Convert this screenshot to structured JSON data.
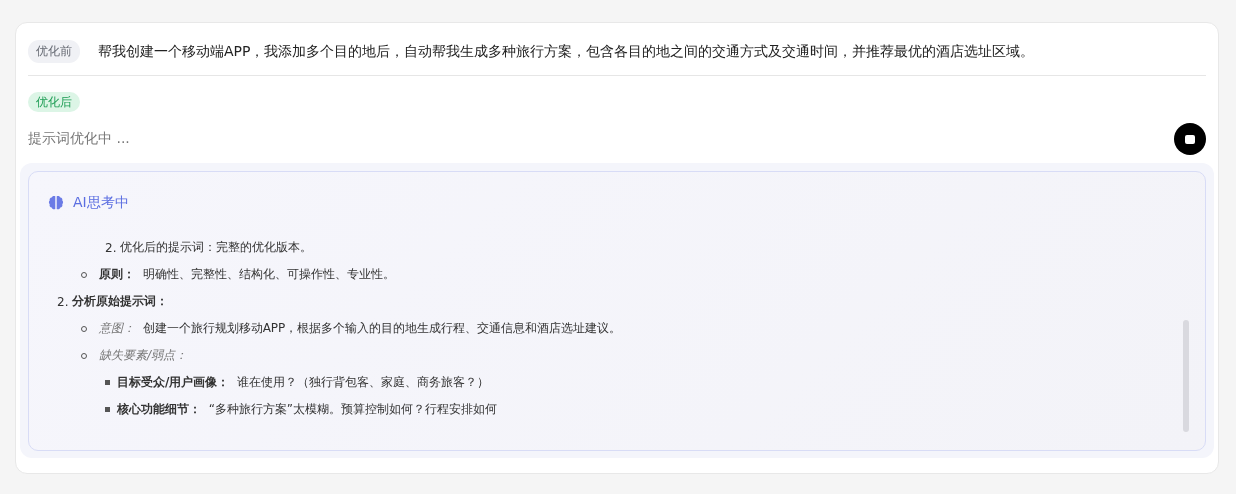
{
  "original": {
    "badge": "优化前",
    "text": "帮我创建一个移动端APP，我添加多个目的地后，自动帮我生成多种旅行方案，包含各目的地之间的交通方式及交通时间，并推荐最优的酒店选址区域。"
  },
  "optimized": {
    "badge": "优化后",
    "status": "提示词优化中 ..."
  },
  "thinking": {
    "title": "AI思考中",
    "outline": [
      {
        "children": [
          {
            "children": [
              {
                "kind": "numbered",
                "marker": "2.",
                "text": "优化后的提示词：完整的优化版本。"
              }
            ]
          },
          {
            "kind": "circle",
            "text": "**原则：**  明确性、完整性、结构化、可操作性、专业性。"
          }
        ]
      },
      {
        "kind": "numbered",
        "marker": "2.",
        "text": "**分析原始提示词：**",
        "children": [
          {
            "kind": "circle",
            "text": "*意图：*  创建一个旅行规划移动APP，根据多个输入的目的地生成行程、交通信息和酒店选址建议。"
          },
          {
            "kind": "circle",
            "text": "*缺失要素/弱点：*",
            "children": [
              {
                "kind": "square",
                "text": "**目标受众/用户画像：**  谁在使用？（独行背包客、家庭、商务旅客？）"
              },
              {
                "kind": "square",
                "text": "**核心功能细节：**  “多种旅行方案”太模糊。预算控制如何？行程安排如何"
              }
            ]
          }
        ]
      }
    ]
  }
}
